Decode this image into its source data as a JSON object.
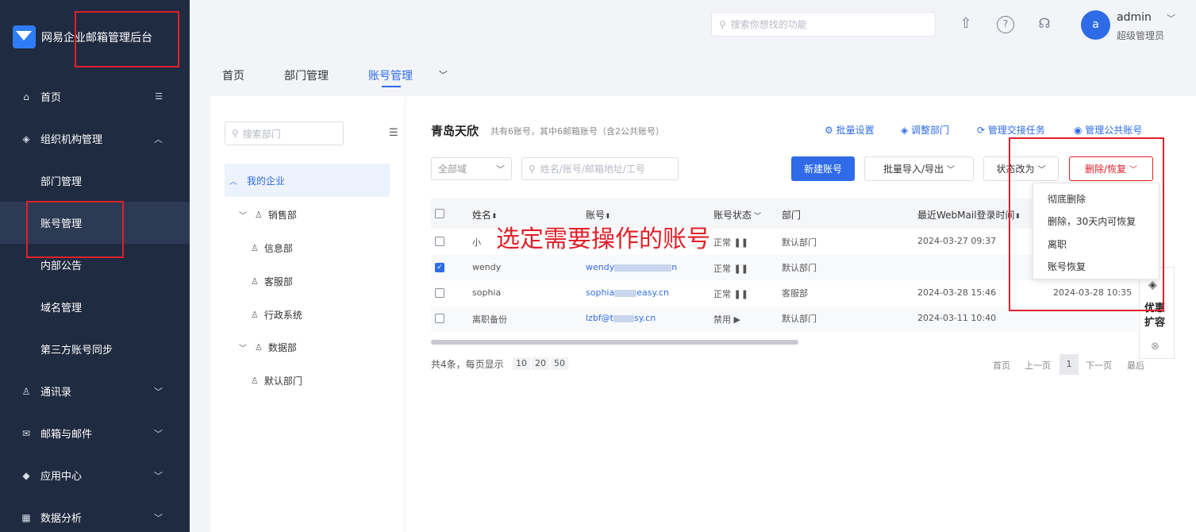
{
  "app": {
    "title": "网易企业邮箱管理后台"
  },
  "sidebar": {
    "items": [
      {
        "label": "首页",
        "icon": "home-icon"
      },
      {
        "label": "组织机构管理",
        "icon": "cube-icon"
      },
      {
        "label": "部门管理"
      },
      {
        "label": "账号管理",
        "active": true
      },
      {
        "label": "内部公告"
      },
      {
        "label": "域名管理"
      },
      {
        "label": "第三方账号同步"
      },
      {
        "label": "通讯录",
        "icon": "person-icon"
      },
      {
        "label": "邮箱与邮件",
        "icon": "mail-icon"
      },
      {
        "label": "应用中心",
        "icon": "app-icon"
      },
      {
        "label": "数据分析",
        "icon": "chart-icon"
      }
    ]
  },
  "header": {
    "search_placeholder": "搜索你想找的功能",
    "avatar_letter": "a",
    "user_name": "admin",
    "user_role": "超级管理员"
  },
  "tabs": [
    {
      "label": "首页"
    },
    {
      "label": "部门管理"
    },
    {
      "label": "账号管理",
      "active": true
    }
  ],
  "dept_panel": {
    "search_placeholder": "搜索部门",
    "root": "我的企业",
    "nodes": [
      "销售部",
      "信息部",
      "客服部",
      "行政系统",
      "数据部",
      "默认部门"
    ]
  },
  "org": {
    "name": "青岛天欣",
    "note": "共有6账号，其中6邮箱账号（含2公共账号）"
  },
  "actions": [
    "批量设置",
    "调整部门",
    "管理交接任务",
    "管理公共账号"
  ],
  "filters": {
    "domain_value": "全部域",
    "search_placeholder": "姓名/账号/邮箱地址/工号"
  },
  "buttons": {
    "new_account": "新建账号",
    "import_export": "批量导入/导出",
    "status_change": "状态改为",
    "delete_restore": "删除/恢复"
  },
  "table": {
    "headers": [
      "姓名",
      "账号",
      "账号状态",
      "部门",
      "最近WebMail登录时间"
    ],
    "rows": [
      {
        "name": "小",
        "account": "",
        "status": "正常",
        "dept": "默认部门",
        "login": "2024-03-27 09:37",
        "extra": "",
        "checked": false
      },
      {
        "name": "wendy",
        "account": "wendy",
        "account_tail": "n",
        "status": "正常",
        "dept": "默认部门",
        "login": "",
        "extra": "",
        "checked": true
      },
      {
        "name": "sophia",
        "account": "sophia",
        "account_tail": "easy.cn",
        "status": "正常",
        "dept": "客服部",
        "login": "2024-03-28 15:46",
        "extra": "2024-03-28 10:35",
        "checked": false
      },
      {
        "name": "离职备份",
        "account": "lzbf@t",
        "account_tail": "sy.cn",
        "status": "禁用",
        "dept": "默认部门",
        "login": "2024-03-11 10:40",
        "extra": "",
        "checked": false
      }
    ]
  },
  "pagination": {
    "summary": "共4条，每页显示",
    "sizes": [
      "10",
      "20",
      "50"
    ],
    "first": "首页",
    "prev": "上一页",
    "current": "1",
    "next": "下一页",
    "last": "最后"
  },
  "dropdown": {
    "items": [
      "彻底删除",
      "删除，30天内可恢复",
      "离职",
      "账号恢复"
    ]
  },
  "float_widget": {
    "label1": "优惠",
    "label2": "扩容"
  },
  "annotation": "选定需要操作的账号",
  "colors": {
    "sidebar_bg": "#1f2b40",
    "accent": "#2f6be6",
    "highlight_red": "#e0202a"
  }
}
